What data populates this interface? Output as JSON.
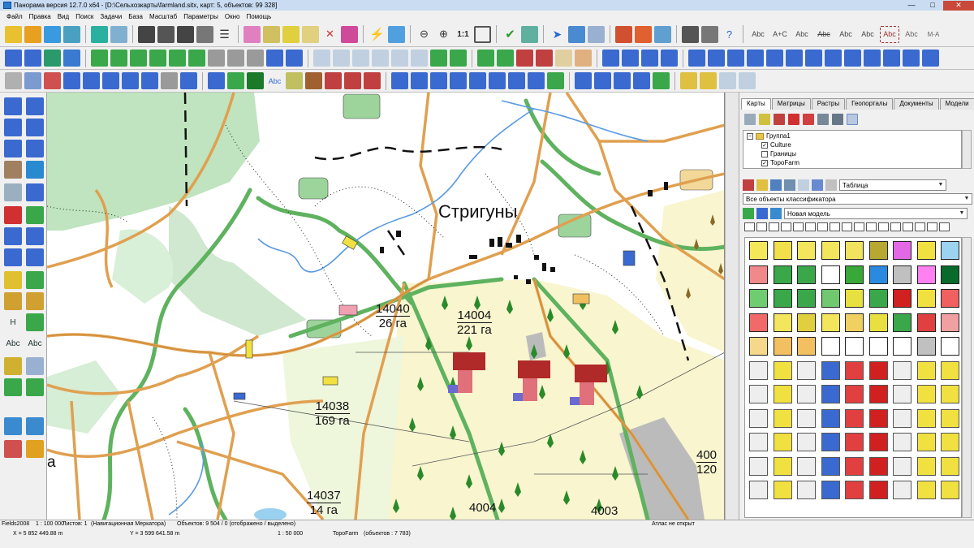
{
  "window": {
    "title": "Панорама версия 12.7.0 x64 - [D:\\Сельхозкарты\\farmland.sitx, карт: 5, объектов: 99 328]",
    "min": "—",
    "max": "□",
    "close": "✕"
  },
  "menu": [
    "Файл",
    "Правка",
    "Вид",
    "Поиск",
    "Задачи",
    "База",
    "Масштаб",
    "Параметры",
    "Окно",
    "Помощь"
  ],
  "toolbar": {
    "zoom_label": "1:1",
    "abc_labels": [
      "Abc",
      "A+C",
      "Abc",
      "Abc",
      "Abc",
      "Abc",
      "Abc",
      "Abc",
      "M-A"
    ]
  },
  "left_toolbar": {
    "h_label": "H",
    "abc1": "Abc",
    "abc2": "Abc"
  },
  "map": {
    "place_name": "Стригуны",
    "cut_letter": "а",
    "parcels": [
      {
        "id": "14040",
        "area": "26 га"
      },
      {
        "id": "14004",
        "area": "221 га"
      },
      {
        "id": "14038",
        "area": "169 га"
      },
      {
        "id": "14037",
        "area": "14 га"
      },
      {
        "id": "4004",
        "area": ""
      },
      {
        "id": "4003",
        "area": ""
      },
      {
        "id": "400",
        "area": "120"
      }
    ]
  },
  "panel": {
    "tabs": [
      "Карты",
      "Матрицы",
      "Растры",
      "Геопорталы",
      "Документы",
      "Модели"
    ],
    "tree": [
      {
        "label": "Группа1",
        "checked": null
      },
      {
        "label": "Culture",
        "checked": true
      },
      {
        "label": "Границы",
        "checked": false
      },
      {
        "label": "TopoFarm",
        "checked": true
      }
    ],
    "view_select": "Таблица",
    "classifier_select": "Все объекты классификатора",
    "model_select": "Новая модель",
    "swatch_colors": [
      "#f4e85a",
      "#f1e04a",
      "#f3e65c",
      "#f3e65c",
      "#f2e35e",
      "#b6a830",
      "#e268e6",
      "#f0e040",
      "#9bd3f0",
      "#f08a8a",
      "#3aa84a",
      "#3aa84a",
      "#ffffff",
      "#38a838",
      "#2a8ae0",
      "#c0c0c0",
      "#ff80f0",
      "#0a6a2a",
      "#70cc70",
      "#3aa84a",
      "#3aa84a",
      "#70c870",
      "#e6e040",
      "#3aa84a",
      "#d02020",
      "#f0e040",
      "#f06060",
      "#f06a6a",
      "#f3e65c",
      "#e0d040",
      "#f3e65c",
      "#f0d060",
      "#e8e040",
      "#3aa84a",
      "#e04040",
      "#f0a0a0",
      "#f5d88a",
      "#f2c060",
      "#f2c060",
      "#ffffff",
      "#ffffff",
      "#ffffff",
      "#ffffff",
      "#c0c0c0",
      "#ffffff"
    ]
  },
  "status": {
    "map_name": "Fields2008",
    "scale": "1 : 100 000",
    "sheets": "Листов: 1",
    "projection": "(Навигационная Меркатора)",
    "objects": "Объектов: 9 504 / 0 (отображено / выделено)",
    "atlas": "Атлас не открыт",
    "coord_x": "X = 5 852 449.88 m",
    "coord_y": "Y = 3 599 641.58 m",
    "scale2": "1 : 50 000",
    "layer": "TopoFarm",
    "layer_objects": "(объектов : 7 783)"
  }
}
